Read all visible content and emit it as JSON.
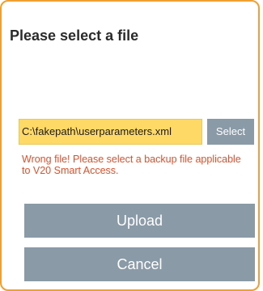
{
  "dialog": {
    "title": "Please select a file",
    "file_value": "C:\\fakepath\\userparameters.xml",
    "select_label": "Select",
    "error_message": "Wrong file! Please select a backup file applicable to V20 Smart Access.",
    "upload_label": "Upload",
    "cancel_label": "Cancel"
  },
  "colors": {
    "border": "#f0a030",
    "file_field_background": "#ffd966",
    "button": "#8a9aa7",
    "error_text": "#e0502a"
  }
}
